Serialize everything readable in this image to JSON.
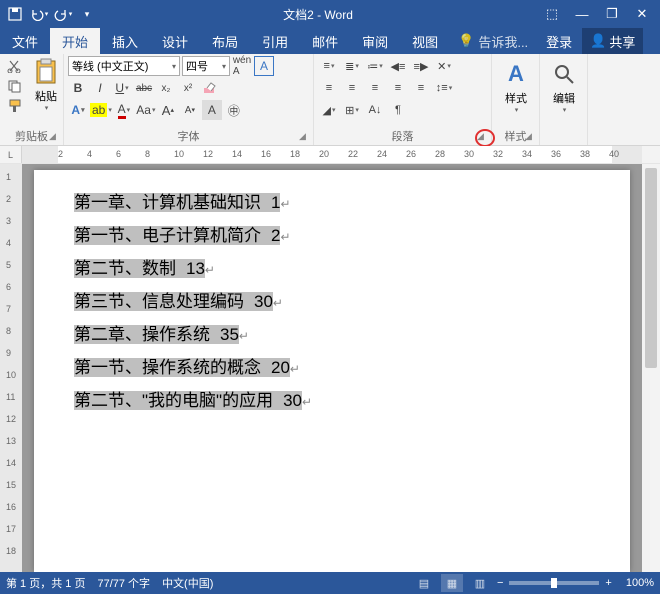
{
  "title": "文档2 - Word",
  "qat": {
    "save": "save-icon",
    "undo": "undo-icon",
    "redo": "redo-icon"
  },
  "win": {
    "ribbon_opts": "⬚",
    "min": "—",
    "restore": "❐",
    "close": "✕"
  },
  "tabs": [
    "文件",
    "开始",
    "插入",
    "设计",
    "布局",
    "引用",
    "邮件",
    "审阅",
    "视图"
  ],
  "active_tab": 1,
  "tell_me": "告诉我...",
  "login": "登录",
  "share": "共享",
  "ribbon": {
    "clipboard": {
      "label": "剪贴板",
      "paste": "粘贴"
    },
    "font": {
      "label": "字体",
      "name": "等线 (中文正文)",
      "size": "四号",
      "buttons": [
        "B",
        "I",
        "U",
        "abc",
        "x₂",
        "x²"
      ],
      "row3": [
        "A",
        "ab",
        "A",
        "Aa",
        "A",
        "A",
        "A",
        "A"
      ]
    },
    "paragraph": {
      "label": "段落"
    },
    "styles": {
      "label": "样式",
      "btn": "样式"
    },
    "editing": {
      "label": "",
      "btn": "编辑"
    }
  },
  "ruler": {
    "marks": [
      2,
      4,
      6,
      8,
      10,
      12,
      14,
      16,
      18,
      20,
      22,
      24,
      26,
      28,
      30,
      32,
      34,
      36,
      38,
      40
    ]
  },
  "vruler": {
    "marks": [
      1,
      2,
      3,
      4,
      5,
      6,
      7,
      8,
      9,
      10,
      11,
      12,
      13,
      14,
      15,
      16,
      17,
      18
    ]
  },
  "document": {
    "lines": [
      {
        "text": "第一章、计算机基础知识",
        "page": "1"
      },
      {
        "text": "第一节、电子计算机简介",
        "page": "2"
      },
      {
        "text": "第二节、数制",
        "page": "13"
      },
      {
        "text": "第三节、信息处理编码",
        "page": "30"
      },
      {
        "text": "第二章、操作系统",
        "page": "35"
      },
      {
        "text": "第一节、操作系统的概念",
        "page": "20"
      },
      {
        "text": "第二节、\"我的电脑\"的应用",
        "page": "30"
      }
    ]
  },
  "status": {
    "page": "第 1 页，共 1 页",
    "words": "77/77 个字",
    "lang": "中文(中国)",
    "zoom": "100%",
    "minus": "−",
    "plus": "+"
  }
}
